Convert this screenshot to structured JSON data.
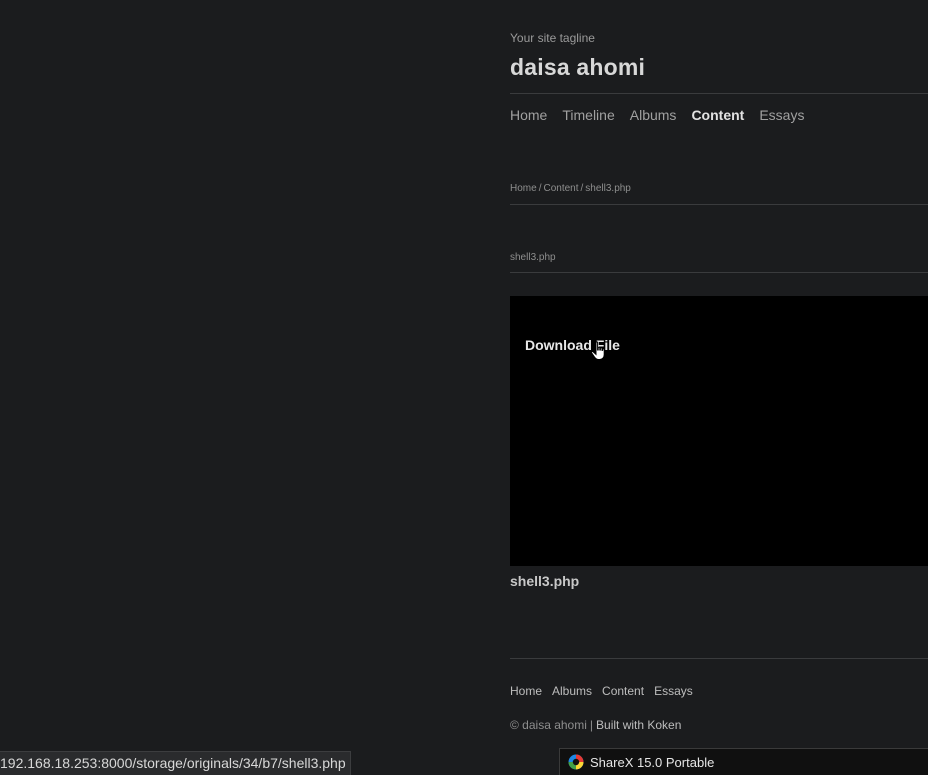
{
  "site": {
    "tagline": "Your site tagline",
    "title": "daisa ahomi"
  },
  "main_nav": [
    {
      "label": "Home",
      "active": false
    },
    {
      "label": "Timeline",
      "active": false
    },
    {
      "label": "Albums",
      "active": false
    },
    {
      "label": "Content",
      "active": true
    },
    {
      "label": "Essays",
      "active": false
    }
  ],
  "breadcrumb": {
    "home": "Home",
    "section": "Content",
    "current": "shell3.php",
    "separator": "/"
  },
  "content": {
    "subtitle": "shell3.php",
    "download_label": "Download File",
    "caption": "shell3.php"
  },
  "footer": {
    "nav": [
      "Home",
      "Albums",
      "Content",
      "Essays"
    ],
    "copyright": "© daisa ahomi",
    "separator": "|",
    "built_with": "Built with Koken"
  },
  "browser": {
    "status_url": "192.168.18.253:8000/storage/originals/34/b7/shell3.php"
  },
  "taskbar": {
    "app_label": "ShareX 15.0 Portable",
    "app_icon": "sharex-icon"
  },
  "colors": {
    "background": "#1b1c1e",
    "media_background": "#000000",
    "active_nav": "#e2e2e2",
    "muted_text": "#8e8e8e"
  }
}
